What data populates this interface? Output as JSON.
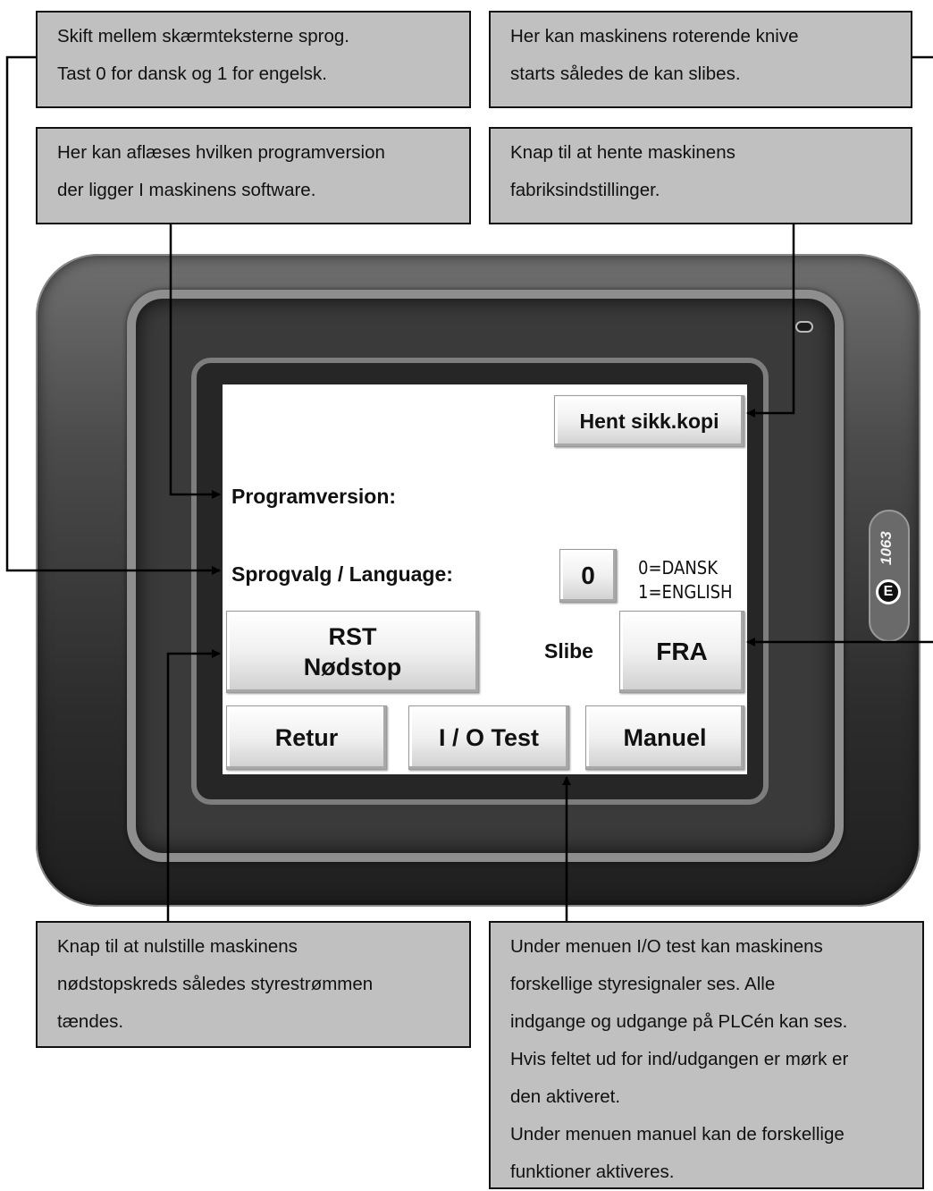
{
  "callouts": {
    "language": [
      "Skift mellem skærmteksterne sprog.",
      "Tast 0 for dansk og 1 for engelsk."
    ],
    "knives": [
      "Her kan maskinens roterende knive",
      "starts således de kan slibes."
    ],
    "version": [
      "Her kan aflæses hvilken programversion",
      "der ligger I maskinens software."
    ],
    "factory": [
      "Knap til at hente maskinens",
      "fabriksindstillinger."
    ],
    "reset": [
      "Knap til at nulstille maskinens",
      "nødstopskreds således styrestrømmen",
      "tændes."
    ],
    "io": [
      "Under menuen I/O test kan maskinens",
      "forskellige styresignaler ses. Alle",
      "indgange og udgange på PLCén kan ses.",
      "Hvis feltet ud for ind/udgangen er mørk er",
      "den aktiveret.",
      "Under menuen manuel kan de forskellige",
      "funktioner aktiveres."
    ]
  },
  "device": {
    "brand_model": "1063",
    "brand_badge": "E"
  },
  "screen": {
    "backup_button": "Hent sikk.kopi",
    "program_version_label": "Programversion:",
    "language_label": "Sprogvalg / Language:",
    "language_value": "0",
    "language_option_0": "0=DANSK",
    "language_option_1": "1=ENGLISH",
    "reset_button_line1": "RST",
    "reset_button_line2": "Nødstop",
    "grind_label": "Slibe",
    "grind_button": "FRA",
    "back_button": "Retur",
    "io_test_button": "I / O Test",
    "manual_button": "Manuel"
  }
}
